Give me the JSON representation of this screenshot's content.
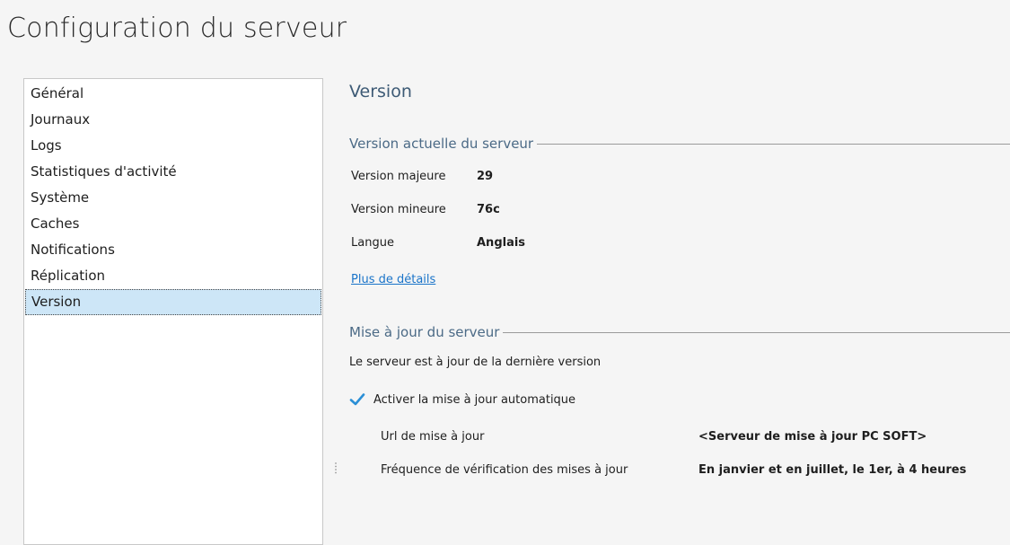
{
  "page": {
    "title": "Configuration du serveur"
  },
  "sidebar": {
    "items": [
      {
        "label": "Général"
      },
      {
        "label": "Journaux"
      },
      {
        "label": "Logs"
      },
      {
        "label": "Statistiques d'activité"
      },
      {
        "label": "Système"
      },
      {
        "label": "Caches"
      },
      {
        "label": "Notifications"
      },
      {
        "label": "Réplication"
      },
      {
        "label": "Version",
        "selected": true
      }
    ]
  },
  "main": {
    "section_title": "Version",
    "current_version": {
      "header": "Version actuelle du serveur",
      "major_label": "Version majeure",
      "major_value": "29",
      "minor_label": "Version mineure",
      "minor_value": "76c",
      "language_label": "Langue",
      "language_value": "Anglais",
      "details_link": "Plus de détails"
    },
    "update": {
      "header": "Mise à jour du serveur",
      "status": "Le serveur est à jour de la dernière version",
      "auto_update_label": "Activer la mise à jour automatique",
      "auto_update_checked": true,
      "url_label": "Url de mise à jour",
      "url_value": "<Serveur de mise à jour PC SOFT>",
      "frequency_label": "Fréquence de vérification des mises à jour",
      "frequency_value": "En janvier et en juillet, le 1er, à 4 heures"
    }
  },
  "colors": {
    "accent": "#1a74c9",
    "selection": "#cde6f7",
    "checkmark": "#2b8fd6",
    "section_text": "#3d5a75"
  }
}
